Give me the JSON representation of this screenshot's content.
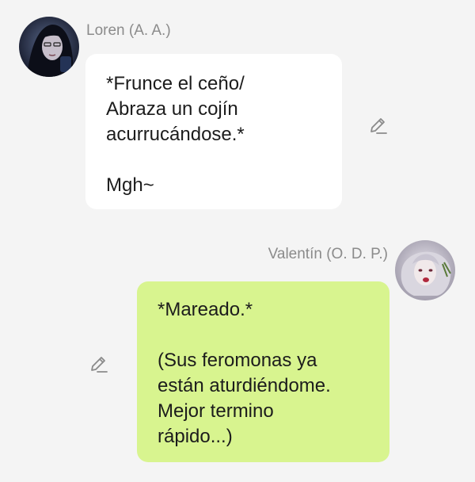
{
  "messages": [
    {
      "sender": "Loren (A. A.)",
      "side": "left",
      "bubble_color": "#ffffff",
      "lines": [
        "*Frunce el ceño/",
        "Abraza un cojín",
        "acurrucándose.*",
        "",
        "Mgh~"
      ],
      "icon": "pencil-icon"
    },
    {
      "sender": "Valentín (O. D. P.)",
      "side": "right",
      "bubble_color": "#d8f48f",
      "lines": [
        "*Mareado.*",
        "",
        "(Sus feromonas ya",
        "están aturdiéndome.",
        "Mejor termino",
        "rápido...)"
      ],
      "icon": "pencil-icon"
    }
  ],
  "colors": {
    "background": "#f4f4f4",
    "sender_name": "#8b8b8b",
    "text": "#1c1c1c",
    "icon": "#8a8a8a"
  }
}
